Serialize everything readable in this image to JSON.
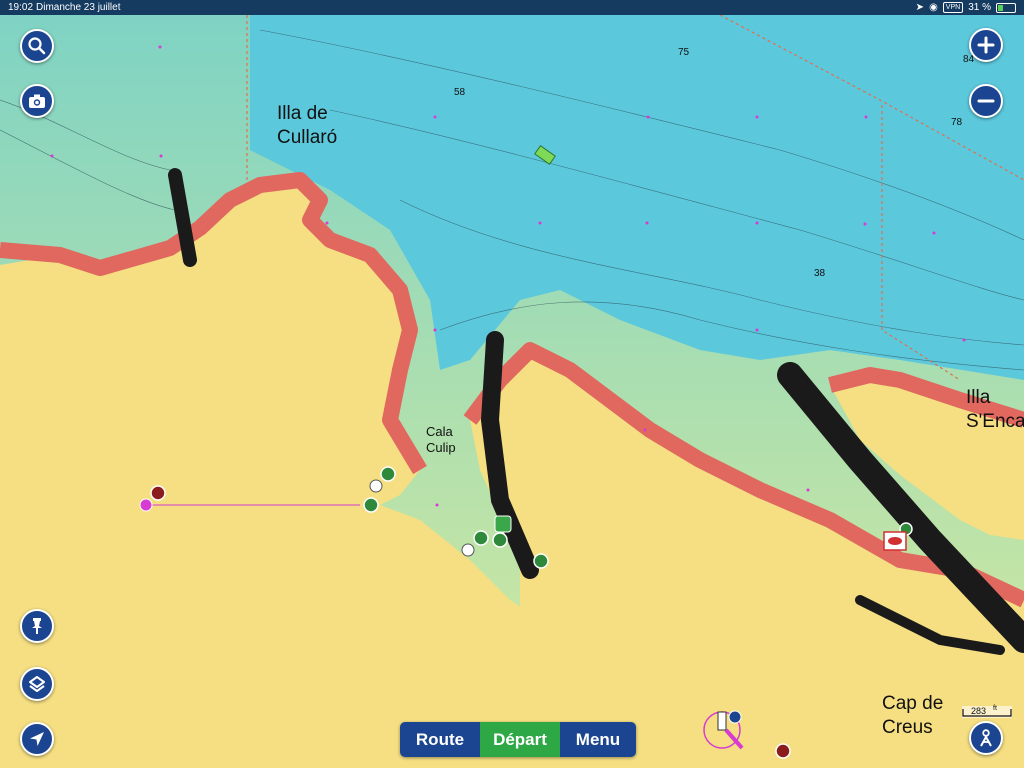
{
  "status": {
    "time": "19:02",
    "date": "Dimanche 23 juillet",
    "vpn": "VPN",
    "battery": "31 %"
  },
  "map": {
    "places": [
      {
        "id": "illa-cullaro",
        "lines": [
          "Illa de",
          "Cullaró"
        ]
      },
      {
        "id": "cala-culip",
        "lines": [
          "Cala",
          "Culip"
        ]
      },
      {
        "id": "illa-sencalladora",
        "lines": [
          "Illa",
          "S'Enca"
        ]
      },
      {
        "id": "cap-creus",
        "lines": [
          "Cap de",
          "Creus"
        ]
      }
    ],
    "depths": [
      "75",
      "84",
      "58",
      "78",
      "38"
    ]
  },
  "toolbar": {
    "search_icon": "search-icon",
    "camera_icon": "camera-icon",
    "zoom_in_icon": "plus-icon",
    "zoom_out_icon": "minus-icon",
    "pin_icon": "pin-icon",
    "layers_icon": "layers-icon",
    "locate_icon": "navigation-arrow-icon",
    "profile_icon": "person-icon"
  },
  "bottom_bar": {
    "route": "Route",
    "depart": "Départ",
    "menu": "Menu"
  },
  "scale": {
    "value": "283",
    "unit": "ft"
  },
  "colors": {
    "land": "#f5df82",
    "shallow": "#e0685f",
    "water": "#5cc8dc",
    "accent": "#1b4590",
    "depart": "#2da845"
  }
}
